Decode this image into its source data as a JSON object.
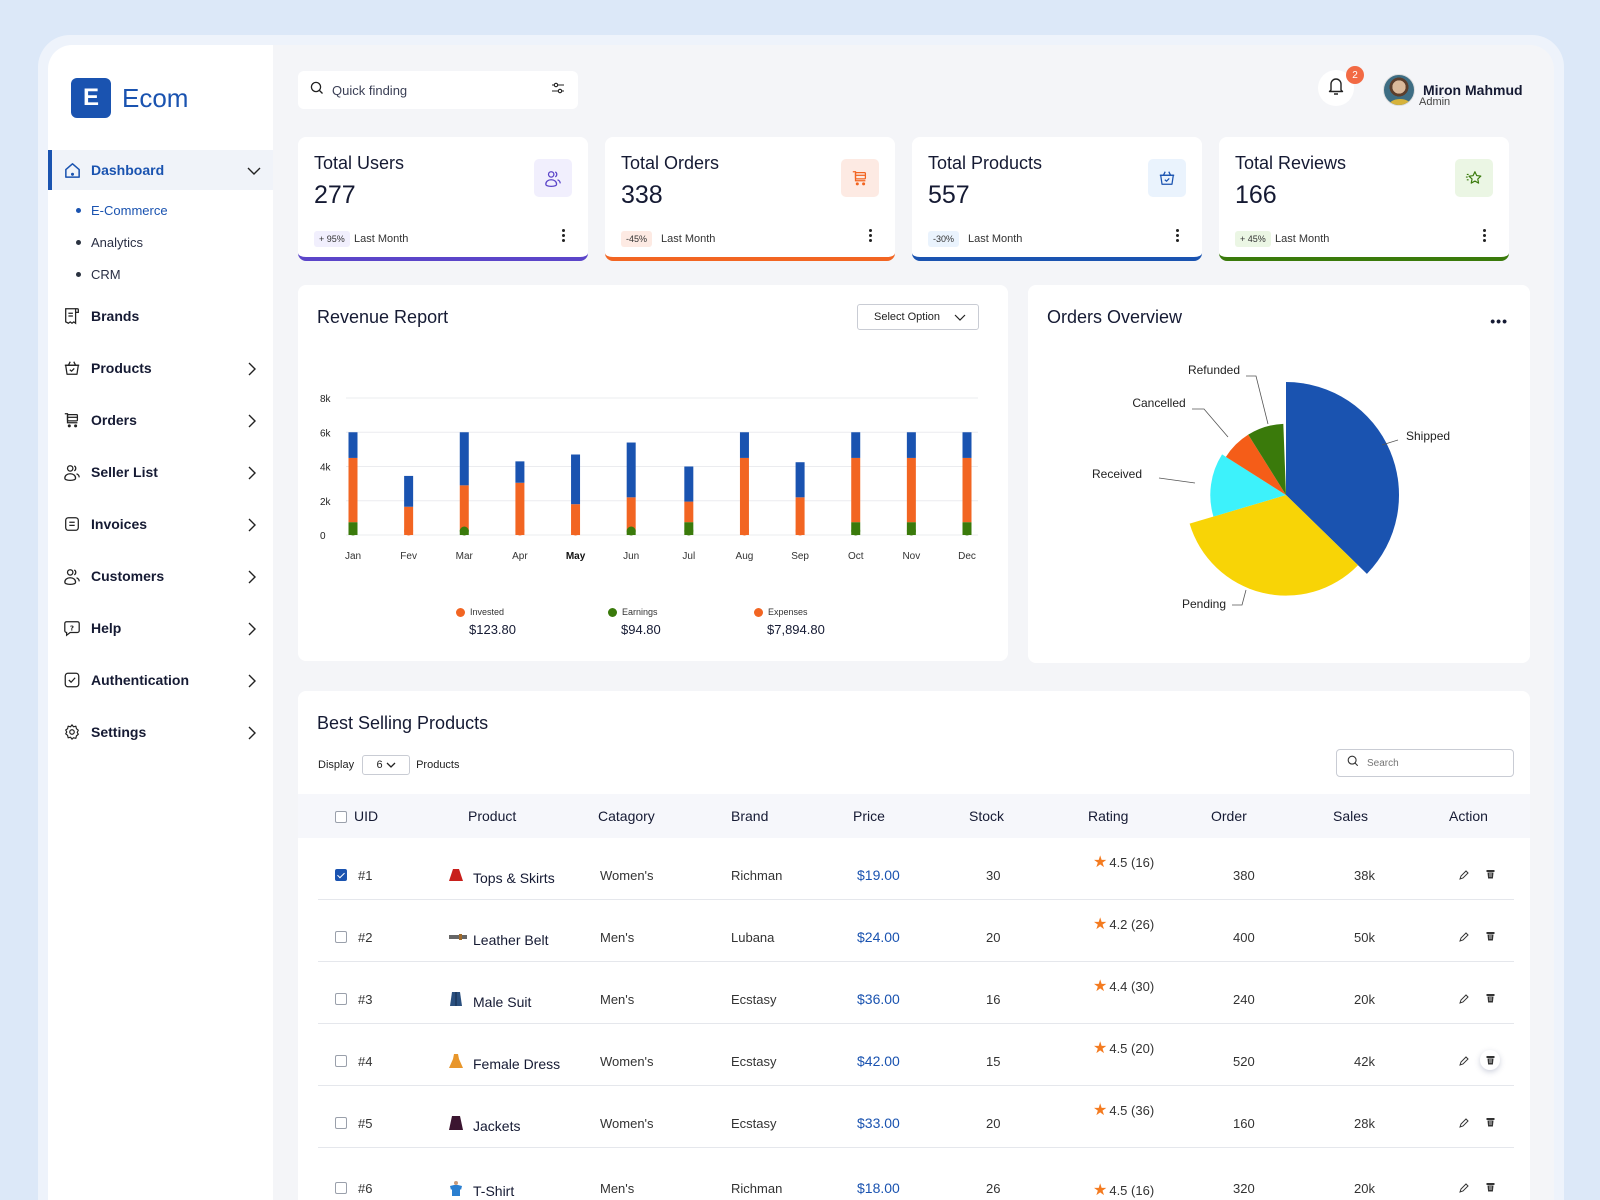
{
  "brand": {
    "logo_letter": "E",
    "name": "Ecom"
  },
  "sidebar": {
    "dashboard": {
      "label": "Dashboard",
      "icon": "home-icon"
    },
    "sub_items": [
      {
        "label": "E-Commerce",
        "active": true
      },
      {
        "label": "Analytics",
        "active": false
      },
      {
        "label": "CRM",
        "active": false
      }
    ],
    "items": [
      {
        "label": "Brands",
        "icon": "receipt-icon",
        "chevron": false
      },
      {
        "label": "Products",
        "icon": "basket-icon",
        "chevron": true
      },
      {
        "label": "Orders",
        "icon": "cart-icon",
        "chevron": true
      },
      {
        "label": "Seller List",
        "icon": "users-icon",
        "chevron": true
      },
      {
        "label": "Invoices",
        "icon": "invoice-icon",
        "chevron": true
      },
      {
        "label": "Customers",
        "icon": "users-icon",
        "chevron": true
      },
      {
        "label": "Help",
        "icon": "help-icon",
        "chevron": true
      },
      {
        "label": "Authentication",
        "icon": "check-square-icon",
        "chevron": true
      },
      {
        "label": "Settings",
        "icon": "gear-icon",
        "chevron": true
      }
    ]
  },
  "topbar": {
    "search_placeholder": "Quick finding",
    "notifications_count": "2",
    "user_name": "Miron Mahmud",
    "user_role": "Admin"
  },
  "stats": [
    {
      "title": "Total Users",
      "value": "277",
      "change": "+ 95%",
      "period": "Last Month",
      "accent": "#5b45c9",
      "icon_bg": "#f1effd",
      "icon": "users-icon"
    },
    {
      "title": "Total Orders",
      "value": "338",
      "change": "-45%",
      "period": "Last Month",
      "accent": "#f26522",
      "icon_bg": "#fdeae3",
      "icon": "cart-icon"
    },
    {
      "title": "Total Products",
      "value": "557",
      "change": "-30%",
      "period": "Last Month",
      "accent": "#1a53b0",
      "icon_bg": "#eaf3fd",
      "icon": "basket-icon"
    },
    {
      "title": "Total Reviews",
      "value": "166",
      "change": "+ 45%",
      "period": "Last Month",
      "accent": "#3a7a0b",
      "icon_bg": "#ebf6e4",
      "icon": "star-icon"
    }
  ],
  "revenue": {
    "title": "Revenue Report",
    "select_label": "Select Option",
    "legend": [
      {
        "label": "Invested",
        "amount": "$123.80",
        "color": "#f26522"
      },
      {
        "label": "Earnings",
        "amount": "$94.80",
        "color": "#3a7a0b"
      },
      {
        "label": "Expenses",
        "amount": "$7,894.80",
        "color": "#f26522"
      }
    ]
  },
  "orders_overview": {
    "title": "Orders Overview",
    "menu_label": "•••"
  },
  "chart_data": [
    {
      "type": "bar",
      "stacked": true,
      "title": "Revenue Report",
      "categories": [
        "Jan",
        "Fev",
        "Mar",
        "Apr",
        "May",
        "Jun",
        "Jul",
        "Aug",
        "Sep",
        "Oct",
        "Nov",
        "Dec"
      ],
      "highlighted_category": "May",
      "yticks": [
        "0",
        "2k",
        "4k",
        "6k",
        "8k"
      ],
      "ylim": [
        0,
        8000
      ],
      "grid": true,
      "series": [
        {
          "name": "Earnings",
          "color": "#3a7a0b",
          "values": [
            750,
            0,
            300,
            0,
            0,
            250,
            750,
            0,
            0,
            750,
            750,
            750
          ]
        },
        {
          "name": "Invested",
          "color": "#f26522",
          "values": [
            3750,
            1650,
            2600,
            3050,
            1800,
            1950,
            1200,
            4500,
            2200,
            3750,
            3750,
            3750
          ]
        },
        {
          "name": "Expenses",
          "color": "#1a53b0",
          "values": [
            1500,
            1800,
            3100,
            1250,
            2900,
            3200,
            2050,
            1500,
            2050,
            1500,
            1500,
            1500
          ]
        }
      ]
    },
    {
      "type": "pie",
      "variant": "rose",
      "title": "Orders Overview",
      "slices": [
        {
          "label": "Shipped",
          "percent": 37.3,
          "relative_radius": 1.0,
          "color": "#1a53b0"
        },
        {
          "label": "Pending",
          "percent": 33.1,
          "relative_radius": 0.89,
          "color": "#f8d406"
        },
        {
          "label": "Received",
          "percent": 13.6,
          "relative_radius": 0.67,
          "color": "#3df2fb"
        },
        {
          "label": "Cancelled",
          "percent": 7.1,
          "relative_radius": 0.63,
          "color": "#f55d18"
        },
        {
          "label": "Refunded",
          "percent": 8.3,
          "relative_radius": 0.63,
          "color": "#3a7a0b"
        }
      ]
    }
  ],
  "table": {
    "title": "Best Selling Products",
    "display_label": "Display",
    "display_value": "6",
    "display_suffix": "Products",
    "search_placeholder": "Search",
    "columns": [
      "UID",
      "Product",
      "Catagory",
      "Brand",
      "Price",
      "Stock",
      "Rating",
      "Order",
      "Sales",
      "Action"
    ],
    "rows": [
      {
        "checked": true,
        "uid": "#1",
        "product": "Tops & Skirts",
        "icon": "skirt-icon",
        "category": "Women's",
        "brand": "Richman",
        "price": "$19.00",
        "stock": "30",
        "rating": "4.5 (16)",
        "order": "380",
        "sales": "38k"
      },
      {
        "checked": false,
        "uid": "#2",
        "product": "Leather Belt",
        "icon": "belt-icon",
        "category": "Men's",
        "brand": "Lubana",
        "price": "$24.00",
        "stock": "20",
        "rating": "4.2 (26)",
        "order": "400",
        "sales": "50k"
      },
      {
        "checked": false,
        "uid": "#3",
        "product": "Male Suit",
        "icon": "suit-icon",
        "category": "Men's",
        "brand": "Ecstasy",
        "price": "$36.00",
        "stock": "16",
        "rating": "4.4 (30)",
        "order": "240",
        "sales": "20k"
      },
      {
        "checked": false,
        "uid": "#4",
        "product": "Female Dress",
        "icon": "dress-icon",
        "category": "Women's",
        "brand": "Ecstasy",
        "price": "$42.00",
        "stock": "15",
        "rating": "4.5 (20)",
        "order": "520",
        "sales": "42k"
      },
      {
        "checked": false,
        "uid": "#5",
        "product": "Jackets",
        "icon": "jacket-icon",
        "category": "Women's",
        "brand": "Ecstasy",
        "price": "$33.00",
        "stock": "20",
        "rating": "4.5 (36)",
        "order": "160",
        "sales": "28k"
      },
      {
        "checked": false,
        "uid": "#6",
        "product": "T-Shirt",
        "icon": "tshirt-icon",
        "category": "Men's",
        "brand": "Richman",
        "price": "$18.00",
        "stock": "26",
        "rating": "4.5 (16)",
        "order": "320",
        "sales": "20k"
      }
    ]
  }
}
